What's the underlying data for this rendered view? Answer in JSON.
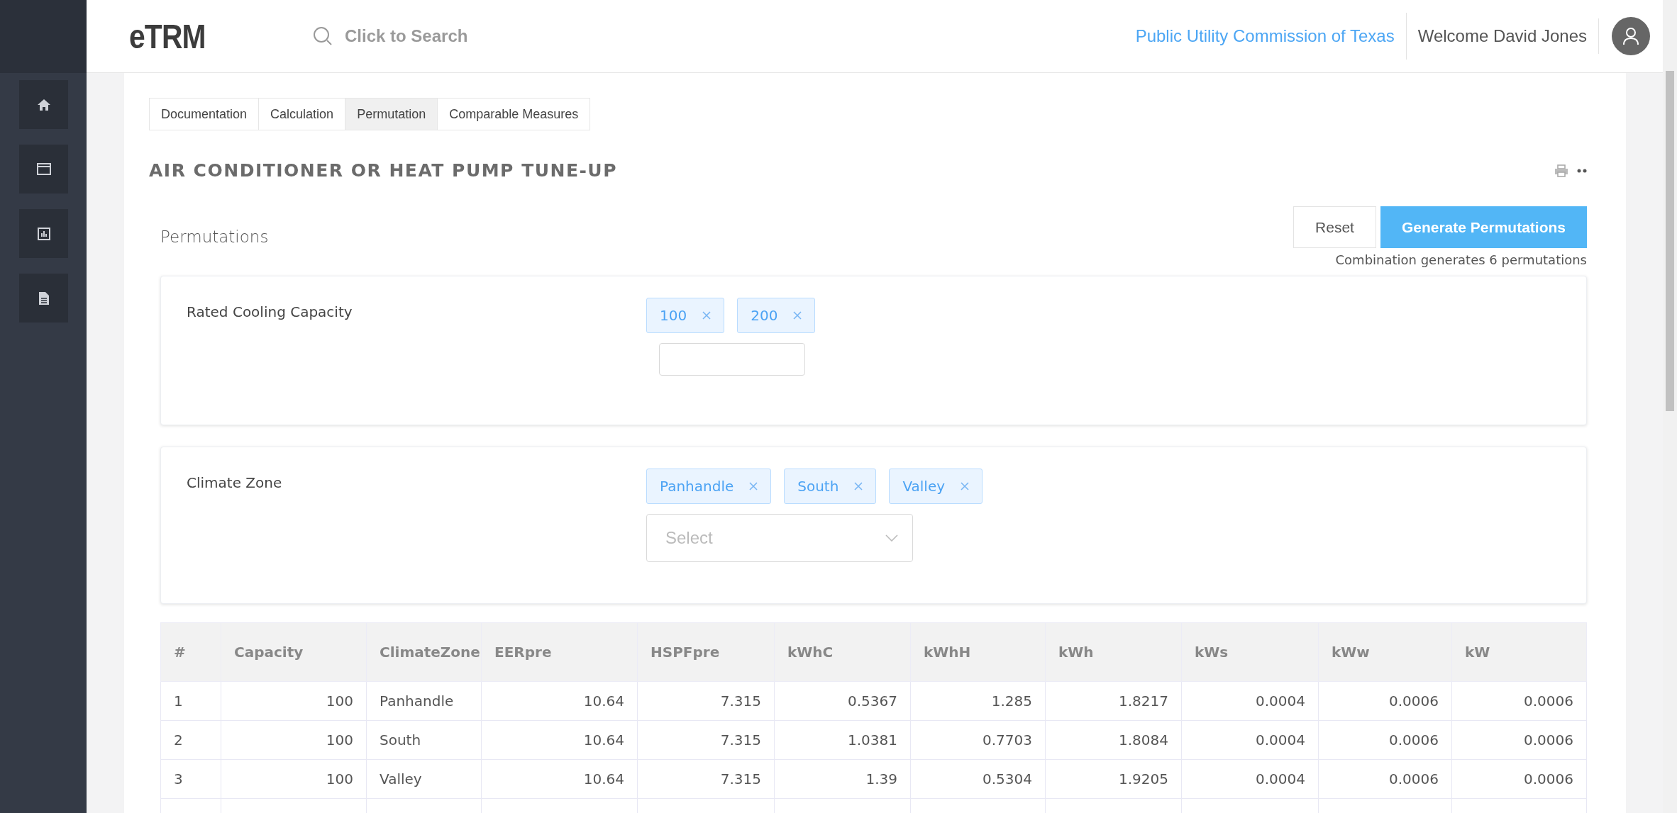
{
  "header": {
    "logo": "eTRM",
    "search": {
      "placeholder": "Click to Search"
    },
    "organization": "Public Utility Commission of Texas",
    "welcome": "Welcome David Jones"
  },
  "sidebar": {
    "items": [
      {
        "kind": "home",
        "selected": false
      },
      {
        "kind": "window",
        "selected": false
      },
      {
        "kind": "chart",
        "selected": false
      },
      {
        "kind": "document",
        "selected": false
      }
    ]
  },
  "tabs": [
    {
      "label": "Documentation",
      "selected": false
    },
    {
      "label": "Calculation",
      "selected": false
    },
    {
      "label": "Permutation",
      "selected": true
    },
    {
      "label": "Comparable Measures",
      "selected": false
    }
  ],
  "title": "AIR CONDITIONER OR HEAT PUMP TUNE-UP",
  "section": {
    "title": "Permutations",
    "reset": "Reset",
    "generate": "Generate Permutations",
    "note": "Combination generates 6 permutations"
  },
  "parameters": [
    {
      "label": "Rated Cooling Capacity",
      "kind": "text",
      "values": [
        "100",
        "200"
      ]
    },
    {
      "label": "Climate Zone",
      "kind": "select",
      "values": [
        "Panhandle",
        "South",
        "Valley"
      ],
      "placeholder": "Select"
    }
  ],
  "table": {
    "columns": [
      "#",
      "Capacity",
      "ClimateZone",
      "EERpre",
      "HSPFpre",
      "kWhC",
      "kWhH",
      "kWh",
      "kWs",
      "kWw",
      "kW"
    ],
    "rows": [
      [
        "1",
        "100",
        "Panhandle",
        "10.64",
        "7.315",
        "0.5367",
        "1.285",
        "1.8217",
        "0.0004",
        "0.0006",
        "0.0006"
      ],
      [
        "2",
        "100",
        "South",
        "10.64",
        "7.315",
        "1.0381",
        "0.7703",
        "1.8084",
        "0.0004",
        "0.0006",
        "0.0006"
      ],
      [
        "3",
        "100",
        "Valley",
        "10.64",
        "7.315",
        "1.39",
        "0.5304",
        "1.9205",
        "0.0004",
        "0.0006",
        "0.0006"
      ]
    ]
  }
}
